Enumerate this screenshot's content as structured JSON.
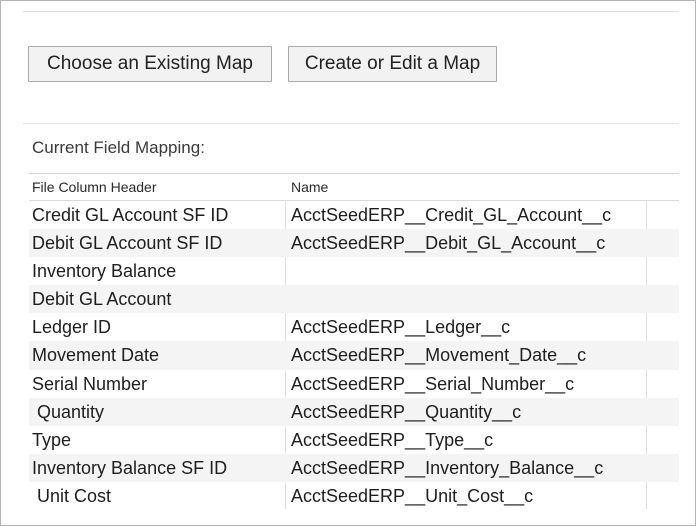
{
  "buttons": {
    "choose_existing": "Choose an Existing Map",
    "create_edit": "Create or Edit a Map"
  },
  "mapping": {
    "label": "Current Field Mapping:",
    "headers": [
      "File Column Header",
      "Name"
    ],
    "rows": [
      {
        "header": "Credit GL Account SF ID",
        "name": "AcctSeedERP__Credit_GL_Account__c"
      },
      {
        "header": "Debit GL Account SF ID",
        "name": "AcctSeedERP__Debit_GL_Account__c"
      },
      {
        "header": "Inventory Balance",
        "name": ""
      },
      {
        "header": "Debit GL Account",
        "name": ""
      },
      {
        "header": "Ledger ID",
        "name": "AcctSeedERP__Ledger__c"
      },
      {
        "header": "Movement Date",
        "name": "AcctSeedERP__Movement_Date__c"
      },
      {
        "header": "Serial Number",
        "name": "AcctSeedERP__Serial_Number__c"
      },
      {
        "header": " Quantity",
        "name": "AcctSeedERP__Quantity__c"
      },
      {
        "header": "Type",
        "name": "AcctSeedERP__Type__c"
      },
      {
        "header": "Inventory Balance SF ID",
        "name": "AcctSeedERP__Inventory_Balance__c"
      },
      {
        "header": " Unit Cost",
        "name": "AcctSeedERP__Unit_Cost__c"
      }
    ]
  }
}
